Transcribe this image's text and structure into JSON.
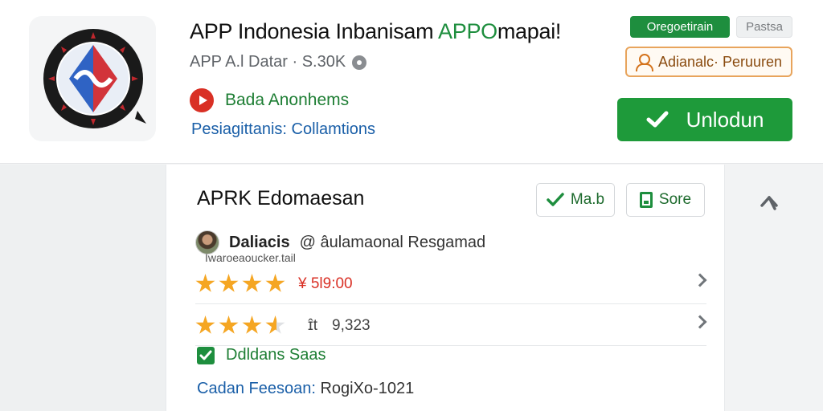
{
  "header": {
    "title_main": "APP Indonesia Inbanisam ",
    "title_accent": "APPO",
    "title_tail": "mapai!",
    "meta": "APP  A.l Datar · S.30K",
    "developer": "Bada Anonhems",
    "category_label": "Pesiagittanis:",
    "category_value": "Collamtions",
    "badge_primary": "Oregoetirain",
    "badge_secondary": "Pastsa",
    "advisor_label": "Adianalc· Peruuren",
    "install_label": "Unlodun"
  },
  "panel": {
    "title": "APRK Edomaesan",
    "mark_label": "Ma.b",
    "save_label": "Sore",
    "reviewer_name": "Daliacis",
    "reviewer_handle": "@ âulamaonal Resgamad",
    "reviewer_sub": "Iwaroeaoucker.tail",
    "rating_1": {
      "stars": 4,
      "price": "¥ 5l9:00"
    },
    "rating_2": {
      "stars": 3.5,
      "count_icon": "ɪ̂t",
      "count": "9,323"
    },
    "verified_label": "Ddldans  Saas",
    "date_label": "Cadan Feesoan:",
    "date_value": "RogiXo-1021"
  },
  "colors": {
    "accent_green": "#1e8e3e",
    "install_green": "#1e9a3a",
    "price_red": "#d93025",
    "link_blue": "#1a5fa8",
    "star": "#f5a623",
    "advisor_border": "#e8a45c"
  },
  "icons": {
    "app": "app-logo-icon",
    "info": "info-icon",
    "developer": "play-badge-icon",
    "advisor": "person-icon",
    "install": "check-icon",
    "mark": "check-icon",
    "save": "bookmark-icon",
    "collapse": "collapse-arrow-icon",
    "row_nav": "chevron-right-icon",
    "verified": "checkbox-icon"
  }
}
